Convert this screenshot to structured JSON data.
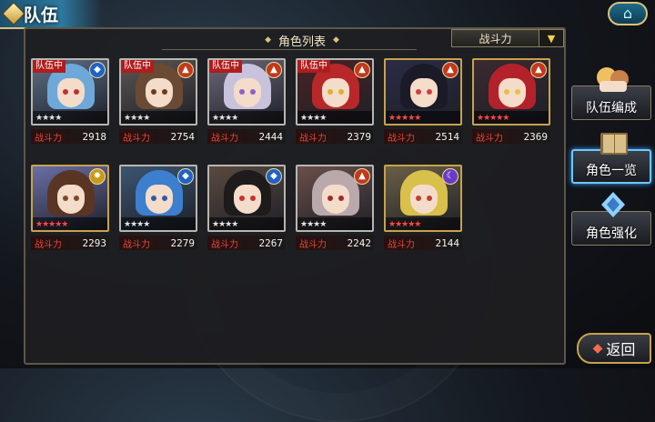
{
  "title": "队伍",
  "panel": {
    "heading": "角色列表",
    "sort": {
      "selected": "战斗力",
      "arrow": "▼"
    }
  },
  "power_label": "战斗力",
  "team_badge_text": "队伍中",
  "characters": [
    {
      "power": "2918",
      "in_team": true,
      "element": "water",
      "element_glyph": "◆",
      "stars": "★★★★",
      "star_color": "silver",
      "hair": "#6ea8d8",
      "eye": "#c03030",
      "bg": "#5d6f86"
    },
    {
      "power": "2754",
      "in_team": true,
      "element": "fire",
      "element_glyph": "▲",
      "stars": "★★★★",
      "star_color": "silver",
      "hair": "#6a4a34",
      "eye": "#6b3a1f",
      "bg": "#5b5653"
    },
    {
      "power": "2444",
      "in_team": true,
      "element": "fire",
      "element_glyph": "▲",
      "stars": "★★★★",
      "star_color": "silver",
      "hair": "#c9c2dc",
      "eye": "#8a62c8",
      "bg": "#6d6878"
    },
    {
      "power": "2379",
      "in_team": true,
      "element": "fire",
      "element_glyph": "▲",
      "stars": "★★★★",
      "star_color": "silver",
      "hair": "#b8282a",
      "eye": "#e0b030",
      "bg": "#4a2324"
    },
    {
      "power": "2514",
      "in_team": false,
      "element": "fire",
      "element_glyph": "▲",
      "stars": "★★★★★",
      "star_color": "red",
      "hair": "#1b1b28",
      "eye": "#d04040",
      "bg": "#2b2c45"
    },
    {
      "power": "2369",
      "in_team": false,
      "element": "fire",
      "element_glyph": "▲",
      "stars": "★★★★★",
      "star_color": "red",
      "hair": "#b3222a",
      "eye": "#e6c040",
      "bg": "#3a2a2f"
    },
    {
      "power": "2293",
      "in_team": false,
      "element": "sun",
      "element_glyph": "✸",
      "stars": "★★★★★",
      "star_color": "red",
      "hair": "#5a3524",
      "eye": "#7a4a2a",
      "bg": "#6a6fa8"
    },
    {
      "power": "2279",
      "in_team": false,
      "element": "water",
      "element_glyph": "◆",
      "stars": "★★★★",
      "star_color": "silver",
      "hair": "#3d7fcf",
      "eye": "#2e5ba8",
      "bg": "#3d5570"
    },
    {
      "power": "2267",
      "in_team": false,
      "element": "water",
      "element_glyph": "◆",
      "stars": "★★★★",
      "star_color": "silver",
      "hair": "#1d1b1c",
      "eye": "#c83030",
      "bg": "#5a4a40"
    },
    {
      "power": "2242",
      "in_team": false,
      "element": "fire",
      "element_glyph": "▲",
      "stars": "★★★★",
      "star_color": "silver",
      "hair": "#b9a9ad",
      "eye": "#a02a2a",
      "bg": "#6a4f4a"
    },
    {
      "power": "2144",
      "in_team": false,
      "element": "dark",
      "element_glyph": "☾",
      "stars": "★★★★★",
      "star_color": "red",
      "hair": "#d8c04a",
      "eye": "#c04030",
      "bg": "#6a5f46"
    }
  ],
  "side_menu": [
    {
      "label": "队伍编成",
      "icon": "team-formation-icon",
      "active": false
    },
    {
      "label": "角色一览",
      "icon": "character-book-icon",
      "active": true
    },
    {
      "label": "角色强化",
      "icon": "enhance-crystal-icon",
      "active": false
    }
  ],
  "back_button": {
    "label": "返回",
    "arrow": "◆"
  },
  "home_button": {
    "glyph": "⌂"
  }
}
